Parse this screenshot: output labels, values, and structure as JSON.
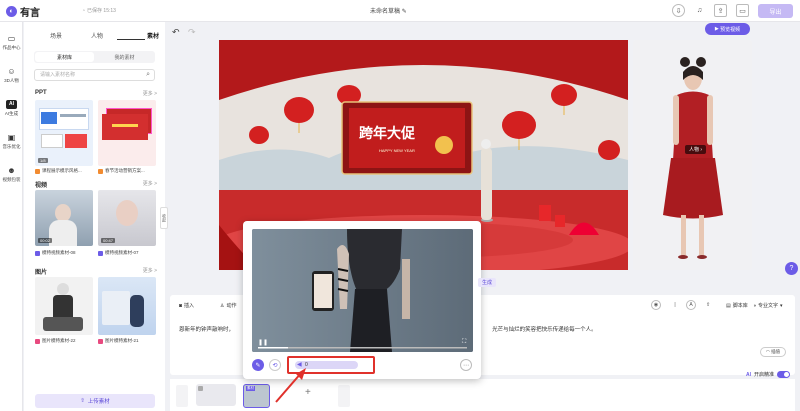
{
  "app": {
    "name": "有言",
    "saved_status": "已保存 15:13",
    "doc_title": "未命名草稿",
    "export_label": "导出"
  },
  "rail": [
    {
      "label": "作品中心",
      "icon": "folder-icon"
    },
    {
      "label": "3D人物",
      "icon": "person-icon"
    },
    {
      "label": "AI生成",
      "icon": "ai-icon"
    },
    {
      "label": "音乐优化",
      "icon": "camera-icon"
    },
    {
      "label": "视频包装",
      "icon": "smile-icon"
    }
  ],
  "panel": {
    "tabs": [
      "场景",
      "人物",
      "素材"
    ],
    "subtabs": [
      "素材库",
      "我的素材"
    ],
    "search_placeholder": "请输入素材名称",
    "sections": {
      "ppt": {
        "title": "PPT",
        "more": "更多 >",
        "items": [
          {
            "caption": "课程展示模示风格...",
            "badge": "1/8"
          },
          {
            "caption": "春节活动营销方案...",
            "badge": ""
          }
        ]
      },
      "video": {
        "title": "视频",
        "more": "更多 >",
        "items": [
          {
            "caption": "模特视频素材-08",
            "badge": "00:02"
          },
          {
            "caption": "模特视频素材-07",
            "badge": "00:47"
          }
        ]
      },
      "image": {
        "title": "图片",
        "more": "更多 >",
        "items": [
          {
            "caption": "图片模特素材-22"
          },
          {
            "caption": "图片模特素材-21"
          }
        ]
      }
    },
    "upload_label": "上传素材",
    "collapse_label": "收起"
  },
  "stage": {
    "poster_title": "跨年大促",
    "poster_sub": "HAPPY NEW YEAR",
    "preview_label": "预览视频",
    "person_tag": "人物"
  },
  "editor": {
    "toolbar": [
      "插入",
      "动作"
    ],
    "script_manage": "脚本库",
    "pro_text": "专业文字",
    "script_text": "恩新年的钟声敲响时，",
    "script_text_tail": "光芒与灿烂的笑容把快乐传递给每一个人。",
    "interp": "插值",
    "smart_mode": "开启精准"
  },
  "popup": {
    "generate_label": "生成",
    "volume_value": "0"
  },
  "timeline": {
    "clip_label": "素材"
  },
  "colors": {
    "accent": "#6c5ce7",
    "stage_red": "#b91d1d",
    "highlight": "#e0312b"
  }
}
